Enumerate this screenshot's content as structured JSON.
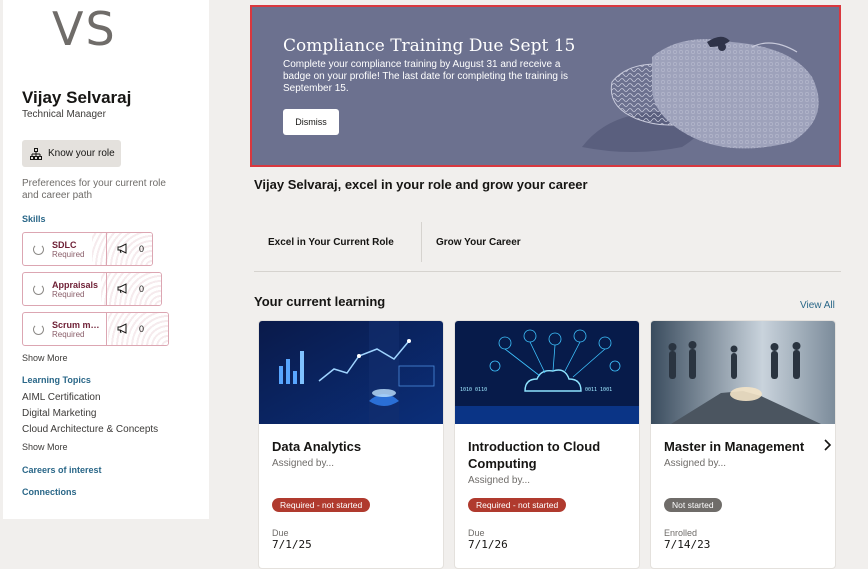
{
  "profile": {
    "initials": "VS",
    "name": "Vijay Selvaraj",
    "title": "Technical Manager",
    "know_role_label": "Know your role",
    "preferences_text": "Preferences for your current role and career path"
  },
  "skills": {
    "heading": "Skills",
    "items": [
      {
        "name": "SDLC",
        "status": "Required",
        "count": "0"
      },
      {
        "name": "Appraisals",
        "status": "Required",
        "count": "0"
      },
      {
        "name": "Scrum ma...",
        "status": "Required",
        "count": "0"
      }
    ],
    "show_more": "Show More"
  },
  "learning_topics": {
    "heading": "Learning Topics",
    "items": [
      "AIML Certification",
      "Digital Marketing",
      "Cloud Architecture & Concepts"
    ],
    "show_more": "Show More"
  },
  "careers_of_interest": "Careers of interest",
  "connections": "Connections",
  "banner": {
    "title": "Compliance Training Due Sept 15",
    "body": "Complete your compliance training by August 31 and receive a badge on your profile! The last date for completing the training is September 15.",
    "dismiss_label": "Dismiss"
  },
  "headline": "Vijay Selvaraj, excel in your role and grow your career",
  "tabs": [
    {
      "label": "Excel in Your Current Role"
    },
    {
      "label": "Grow Your Career"
    }
  ],
  "current_learning": {
    "title": "Your current learning",
    "view_all": "View All",
    "cards": [
      {
        "title": "Data Analytics",
        "sub": "Assigned by...",
        "badge": "Required - not started",
        "date_label": "Due",
        "date": "7/1/25"
      },
      {
        "title": "Introduction to Cloud Computing",
        "sub": "Assigned by...",
        "badge": "Required - not started",
        "date_label": "Due",
        "date": "7/1/26"
      },
      {
        "title": "Master in Management",
        "sub": "Assigned by...",
        "badge": "Not started",
        "date_label": "Enrolled",
        "date": "7/14/23"
      }
    ]
  },
  "colors": {
    "banner_bg": "#6c718f",
    "banner_outline": "#d9383f",
    "link": "#2a6788",
    "badge_required": "#b03a2e",
    "badge_neutral": "#6f6c69"
  }
}
